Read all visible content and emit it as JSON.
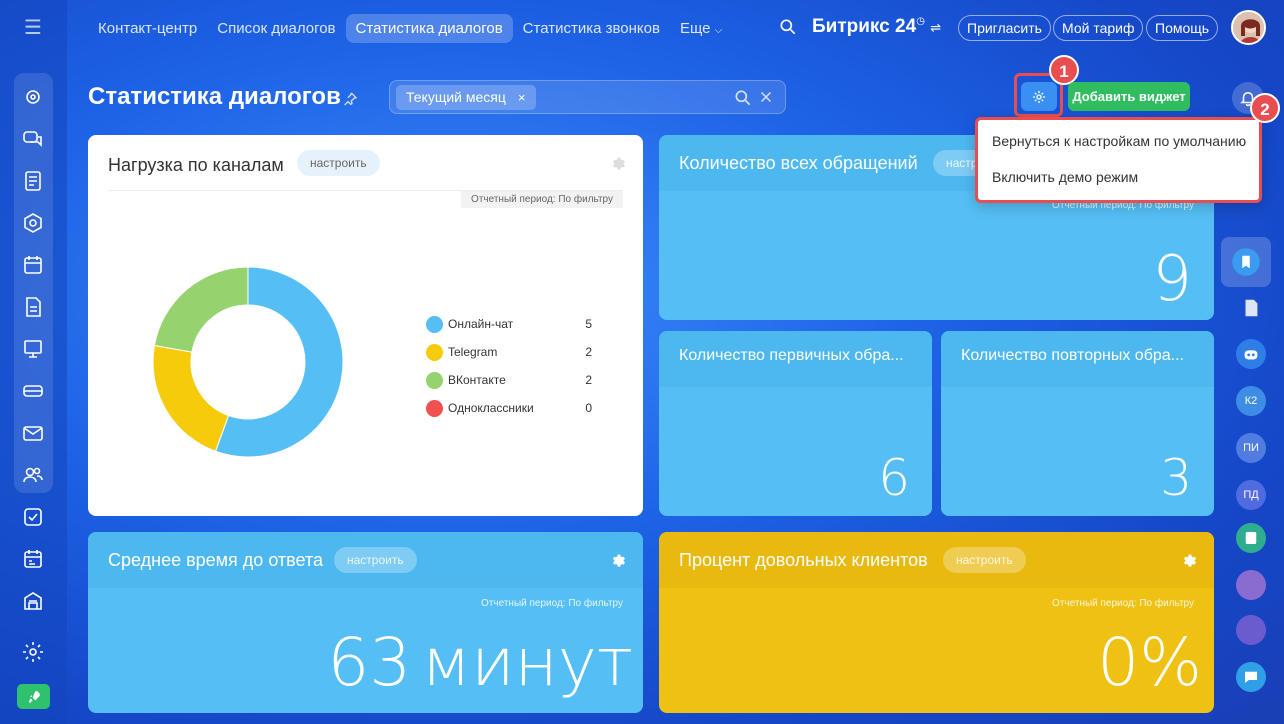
{
  "topnav": {
    "items": [
      "Контакт-центр",
      "Список диалогов",
      "Статистика диалогов",
      "Статистика звонков",
      "Еще"
    ],
    "active_index": 2,
    "brand": "Битрикс",
    "brand_num": "24",
    "invite": "Пригласить",
    "tariff": "Мой тариф",
    "help": "Помощь"
  },
  "page": {
    "title": "Статистика диалогов",
    "filter_chip": "Текущий месяц",
    "chip_close": "×",
    "add_widget": "Добавить виджет"
  },
  "badges": {
    "one": "1",
    "two": "2"
  },
  "dropdown": {
    "items": [
      "Вернуться к настройкам по умолчанию",
      "Включить демо режим"
    ]
  },
  "widgets": {
    "channels": {
      "title": "Нагрузка по каналам",
      "config": "настроить",
      "period": "Отчетный период: По фильтру"
    },
    "all_requests": {
      "title": "Количество всех обращений",
      "config": "настр",
      "period": "Отчетный период: По фильтру",
      "value": "9"
    },
    "first_requests": {
      "title": "Количество первичных обра...",
      "value": "6"
    },
    "repeat_requests": {
      "title": "Количество повторных обра...",
      "value": "3"
    },
    "response_time": {
      "title": "Среднее время до ответа",
      "config": "настроить",
      "period": "Отчетный период: По фильтру",
      "value": "63",
      "unit": "минут"
    },
    "satisfied": {
      "title": "Процент довольных клиентов",
      "config": "настроить",
      "period": "Отчетный период: По фильтру",
      "value": "0%"
    }
  },
  "chart_data": {
    "type": "pie",
    "categories": [
      "Онлайн-чат",
      "Telegram",
      "ВКонтакте",
      "Одноклассники"
    ],
    "values": [
      5,
      2,
      2,
      0
    ],
    "colors": [
      "#55bff5",
      "#f5cb0c",
      "#96d36f",
      "#f0504f"
    ],
    "title": "Нагрузка по каналам",
    "legend": "right"
  },
  "right_bar": {
    "k2": "К2",
    "pi": "ПИ",
    "pd": "ПД"
  },
  "colors": {
    "accent": "#2fbd5f",
    "highlight": "#e84e50",
    "blue_card": "#55bff5",
    "yellow_card": "#eec113"
  }
}
